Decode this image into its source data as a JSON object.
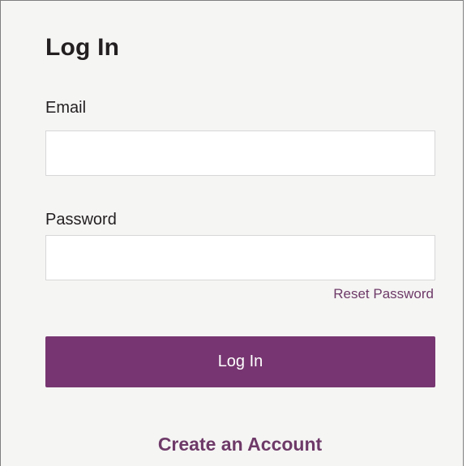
{
  "login_form": {
    "title": "Log In",
    "email": {
      "label": "Email",
      "value": ""
    },
    "password": {
      "label": "Password",
      "value": ""
    },
    "reset_password_label": "Reset Password",
    "submit_label": "Log In",
    "create_account_label": "Create an Account"
  },
  "colors": {
    "accent": "#773671",
    "link": "#6e3a68",
    "panel_background": "#f5f5f4",
    "text": "#231f20"
  }
}
